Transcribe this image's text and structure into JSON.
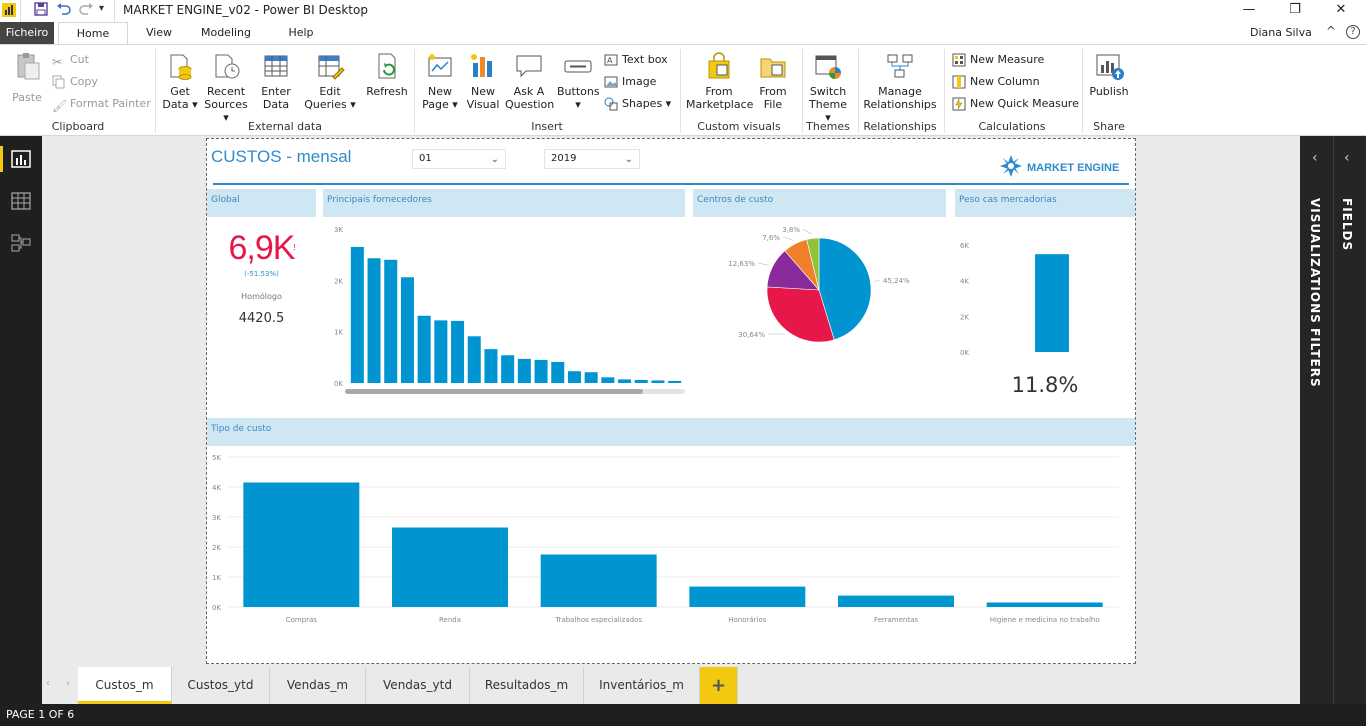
{
  "window": {
    "title": "MARKET ENGINE_v02 - Power BI Desktop",
    "user": "Diana Silva",
    "controls": [
      "—",
      "❐",
      "✕"
    ]
  },
  "ribbon_tabs": [
    "Ficheiro",
    "Home",
    "View",
    "Modeling",
    "Help"
  ],
  "clipboard": {
    "paste": "Paste",
    "cut": "Cut",
    "copy": "Copy",
    "format_painter": "Format Painter",
    "group": "Clipboard"
  },
  "external_data": {
    "get_data": [
      "Get",
      "Data ▾"
    ],
    "recent_sources": [
      "Recent",
      "Sources ▾"
    ],
    "enter_data": [
      "Enter",
      "Data"
    ],
    "edit_queries": [
      "Edit",
      "Queries ▾"
    ],
    "refresh": "Refresh",
    "group": "External data"
  },
  "insert": {
    "new_page": [
      "New",
      "Page ▾"
    ],
    "new_visual": [
      "New",
      "Visual"
    ],
    "ask_question": [
      "Ask A",
      "Question"
    ],
    "buttons": [
      "Buttons",
      "▾"
    ],
    "text_box": "Text box",
    "image": "Image",
    "shapes": "Shapes ▾",
    "group": "Insert"
  },
  "custom_visuals": {
    "from_marketplace": [
      "From",
      "Marketplace"
    ],
    "from_file": [
      "From",
      "File"
    ],
    "group": "Custom visuals"
  },
  "themes": {
    "switch_theme": [
      "Switch",
      "Theme ▾"
    ],
    "group": "Themes"
  },
  "relationships": {
    "manage": [
      "Manage",
      "Relationships"
    ],
    "group": "Relationships"
  },
  "calculations": {
    "new_measure": "New Measure",
    "new_column": "New Column",
    "new_quick_measure": "New Quick Measure",
    "group": "Calculations"
  },
  "share": {
    "publish": "Publish",
    "group": "Share"
  },
  "right_pane": {
    "visualizations": "VISUALIZATIONS",
    "filters": "FIELDS",
    "filters2": "FILTERS"
  },
  "report": {
    "title": "CUSTOS - mensal",
    "month_slicer": "01",
    "year_slicer": "2019",
    "logo_text": "MARKET ENGINE",
    "global": {
      "title": "Global",
      "value": "6,9K",
      "change": "(-51.53%)",
      "homologo_label": "Homólogo",
      "homologo_value": "4420.5"
    },
    "suppliers_title": "Principais fornecedores",
    "centros_title": "Centros de custo",
    "peso_title": "Peso cas mercadorias",
    "peso_value": "11.8%",
    "tipo_title": "Tipo de custo"
  },
  "chart_data": [
    {
      "type": "bar",
      "title": "Principais fornecedores",
      "yticks": [
        "3K",
        "2K",
        "1K",
        "0K"
      ],
      "ylim": [
        0,
        3000
      ],
      "values": [
        2650,
        2430,
        2400,
        2060,
        1310,
        1220,
        1210,
        910,
        660,
        540,
        470,
        450,
        410,
        230,
        210,
        110,
        70,
        60,
        50,
        40
      ],
      "color": "#0095d0"
    },
    {
      "type": "pie",
      "title": "Centros de custo",
      "slices": [
        {
          "label": "45,24%",
          "value": 45.24,
          "color": "#0095d0"
        },
        {
          "label": "30,64%",
          "value": 30.64,
          "color": "#e8174a"
        },
        {
          "label": "12,63%",
          "value": 12.63,
          "color": "#8b2a9a"
        },
        {
          "label": "7,6%",
          "value": 7.6,
          "color": "#f0812a"
        },
        {
          "label": "3,8%",
          "value": 3.8,
          "color": "#8fc43a"
        }
      ]
    },
    {
      "type": "bar",
      "title": "Peso cas mercadorias",
      "yticks": [
        "6K",
        "4K",
        "2K",
        "0K"
      ],
      "ylim": [
        0,
        7000
      ],
      "values": [
        6400
      ],
      "color": "#0095d0"
    },
    {
      "type": "bar",
      "title": "Tipo de custo",
      "yticks": [
        "5K",
        "4K",
        "3K",
        "2K",
        "1K",
        "0K"
      ],
      "ylim": [
        0,
        5000
      ],
      "categories": [
        "Compras",
        "Renda",
        "Trabalhos especializados",
        "Honorários",
        "Ferramentas",
        "Higiene e medicina no trabalho"
      ],
      "values": [
        4150,
        2650,
        1750,
        680,
        380,
        150
      ],
      "color": "#0095d0"
    }
  ],
  "page_tabs": [
    "Custos_m",
    "Custos_ytd",
    "Vendas_m",
    "Vendas_ytd",
    "Resultados_m",
    "Inventários_m"
  ],
  "add_page": "+",
  "status": "PAGE 1 OF 6"
}
